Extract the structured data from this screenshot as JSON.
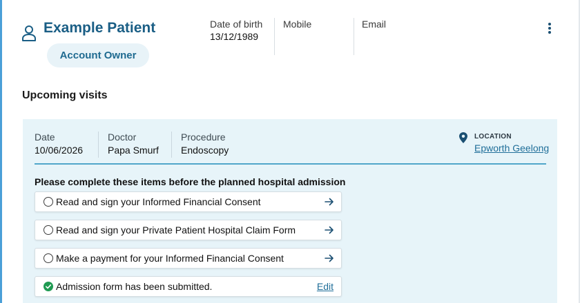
{
  "patient": {
    "name": "Example Patient",
    "badge": "Account Owner"
  },
  "info": {
    "dob_label": "Date of birth",
    "dob_value": "13/12/1989",
    "mobile_label": "Mobile",
    "mobile_value": "",
    "email_label": "Email",
    "email_value": ""
  },
  "icons": {
    "user": "user-icon",
    "more": "kebab-menu-icon",
    "location": "map-pin-icon",
    "arrow": "arrow-right-icon",
    "done": "check-circle-icon"
  },
  "colors": {
    "brand": "#1a5e85",
    "panel": "#e7f4f9",
    "accent_rule": "#4fa6c9",
    "success": "#1f9a52",
    "link": "#1f6e99"
  },
  "upcoming": {
    "title": "Upcoming visits",
    "visit": {
      "date_label": "Date",
      "date_value": "10/06/2026",
      "doctor_label": "Doctor",
      "doctor_value": "Papa Smurf",
      "procedure_label": "Procedure",
      "procedure_value": "Endoscopy",
      "location_label": "LOCATION",
      "location_value": "Epworth Geelong"
    },
    "todo_heading": "Please complete these items before the planned hospital admission",
    "todos": [
      {
        "label": "Read and sign your Informed Financial Consent",
        "status": "pending"
      },
      {
        "label": "Read and sign your Private Patient Hospital Claim Form",
        "status": "pending"
      },
      {
        "label": "Make a payment for your Informed Financial Consent",
        "status": "pending"
      },
      {
        "label": "Admission form has been submitted.",
        "status": "complete",
        "action": "Edit"
      }
    ]
  }
}
